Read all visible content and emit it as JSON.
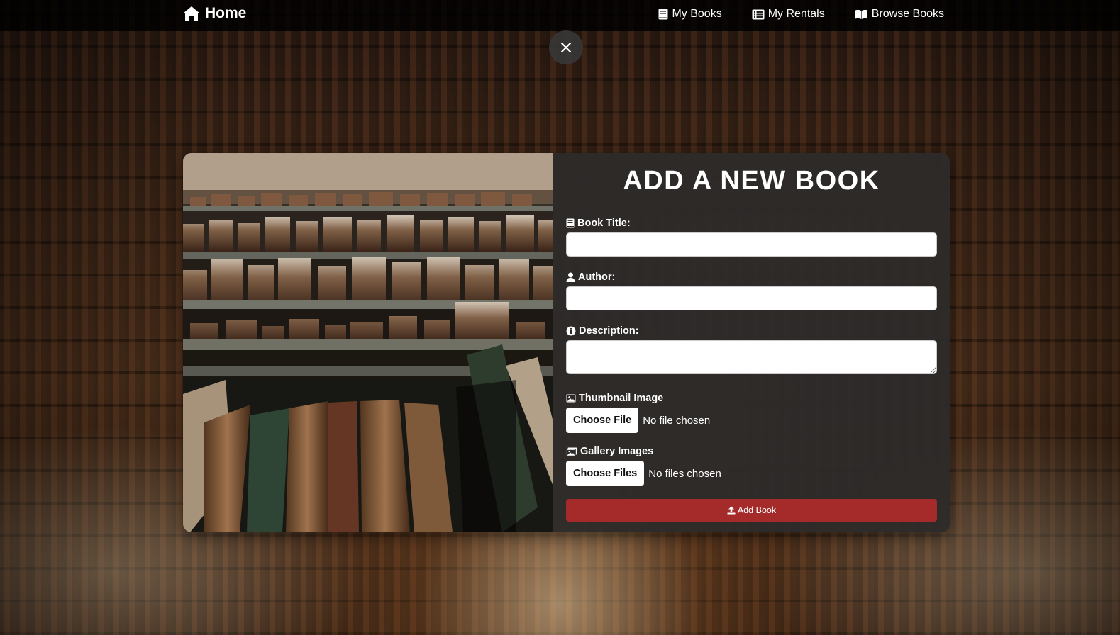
{
  "nav": {
    "brand_label": "Home",
    "links": [
      {
        "label": "My Books",
        "icon": "book-icon"
      },
      {
        "label": "My Rentals",
        "icon": "list-icon"
      },
      {
        "label": "Browse Books",
        "icon": "open-book-icon"
      }
    ]
  },
  "modal": {
    "close_icon": "close-icon",
    "title": "ADD A NEW BOOK",
    "fields": {
      "title_label": "Book Title:",
      "author_label": "Author:",
      "description_label": "Description:",
      "thumbnail_label": "Thumbnail Image",
      "gallery_label": "Gallery Images"
    },
    "thumbnail": {
      "button": "Choose File",
      "status": "No file chosen"
    },
    "gallery": {
      "button": "Choose Files",
      "status": "No files chosen"
    },
    "submit_label": "Add Book"
  },
  "colors": {
    "accent": "#a52a2a",
    "navbar": "#000000",
    "modal_panel": "#2d2b2a"
  }
}
